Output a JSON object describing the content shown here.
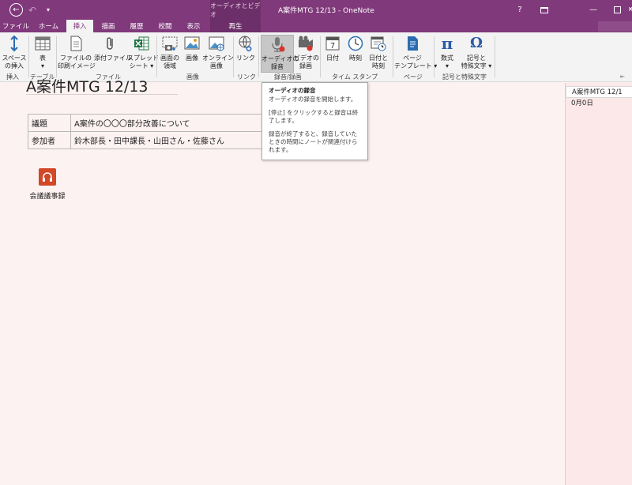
{
  "titlebar": {
    "context_group": "オーディオとビデオ",
    "window_title": "A案件MTG  12/13 - OneNote",
    "help": "?",
    "minimize": "—",
    "close": "✕"
  },
  "tabs": [
    {
      "label": "ファイル"
    },
    {
      "label": "ホーム"
    },
    {
      "label": "挿入"
    },
    {
      "label": "描画"
    },
    {
      "label": "履歴"
    },
    {
      "label": "校閲"
    },
    {
      "label": "表示"
    },
    {
      "label": "再生"
    }
  ],
  "ribbon": {
    "insert_space": {
      "line1": "スペース",
      "line2": "の挿入"
    },
    "table": {
      "line1": "表",
      "line2": "▾"
    },
    "printout": {
      "line1": "ファイルの",
      "line2": "印刷イメージ"
    },
    "attach": {
      "line1": "添付ファイル",
      "line2": ""
    },
    "spreadsheet": {
      "line1": "スプレッド",
      "line2": "シート ▾"
    },
    "screen_clip": {
      "line1": "画面の",
      "line2": "領域"
    },
    "picture": {
      "line1": "画像",
      "line2": ""
    },
    "online_picture": {
      "line1": "オンライン",
      "line2": "画像"
    },
    "link": {
      "line1": "リンク",
      "line2": ""
    },
    "record_audio": {
      "line1": "オーディオの",
      "line2": "録音"
    },
    "record_video": {
      "line1": "ビデオの",
      "line2": "録画"
    },
    "date": {
      "line1": "日付",
      "day": "7"
    },
    "time": {
      "line1": "時刻"
    },
    "date_time": {
      "line1": "日付と",
      "line2": "時刻"
    },
    "page_template": {
      "line1": "ページ",
      "line2": "テンプレート ▾"
    },
    "equation": {
      "line1": "数式",
      "line2": "▾",
      "glyph": "π"
    },
    "symbol": {
      "line1": "記号と",
      "line2": "特殊文字 ▾",
      "glyph": "Ω"
    },
    "groups": {
      "insert": "挿入",
      "tables": "テーブル",
      "files": "ファイル",
      "images": "画像",
      "links": "リンク",
      "recording": "録音/録画",
      "timestamp": "タイム スタンプ",
      "pages": "ページ",
      "symbols": "記号と特殊文字"
    }
  },
  "page": {
    "title": "A案件MTG  12/13",
    "table": [
      {
        "key": "議題",
        "value": "A案件の〇〇〇部分改善について"
      },
      {
        "key": "参加者",
        "value": "鈴木部長・田中課長・山田さん・佐藤さん"
      }
    ],
    "attachment_name": "会議議事録"
  },
  "pagelist": {
    "active_page": "A案件MTG  12/1",
    "sub_label": "0月0日"
  },
  "tooltip": {
    "title": "オーディオの録音",
    "line1": "オーディオの録音を開始します。",
    "line2": "[停止] をクリックすると録音は終了します。",
    "line3": "録音が終了すると、録音していたときの時間にノートが関連付けられます。"
  },
  "colors": {
    "brand": "#80397b",
    "context_tab": "#6d2f69",
    "page_bg": "#fdf2f2",
    "audio_icon": "#d24726"
  }
}
